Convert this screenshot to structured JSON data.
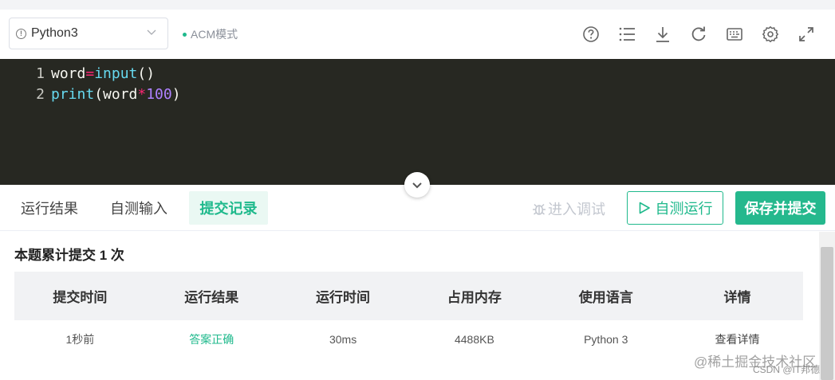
{
  "toolbar": {
    "language": "Python3",
    "mode_label": "ACM模式",
    "icons": [
      "help-icon",
      "list-icon",
      "download-icon",
      "refresh-icon",
      "keyboard-icon",
      "settings-icon",
      "fullscreen-icon"
    ]
  },
  "editor": {
    "lines": [
      {
        "number": "1",
        "tokens": [
          {
            "text": "word",
            "kind": "plain"
          },
          {
            "text": "=",
            "kind": "op"
          },
          {
            "text": "input",
            "kind": "fn"
          },
          {
            "text": "()",
            "kind": "plain"
          }
        ]
      },
      {
        "number": "2",
        "tokens": [
          {
            "text": "print",
            "kind": "fn"
          },
          {
            "text": "(word",
            "kind": "plain"
          },
          {
            "text": "*",
            "kind": "op"
          },
          {
            "text": "100",
            "kind": "num"
          },
          {
            "text": ")",
            "kind": "plain"
          }
        ]
      }
    ]
  },
  "tabs": [
    {
      "label": "运行结果",
      "active": false
    },
    {
      "label": "自测输入",
      "active": false
    },
    {
      "label": "提交记录",
      "active": true
    }
  ],
  "actions": {
    "debug": "进入调试",
    "run": "自测运行",
    "submit": "保存并提交"
  },
  "results": {
    "summary": "本题累计提交 1 次",
    "headers": [
      "提交时间",
      "运行结果",
      "运行时间",
      "占用内存",
      "使用语言",
      "详情"
    ],
    "rows": [
      [
        "1秒前",
        "答案正确",
        "30ms",
        "4488KB",
        "Python 3",
        "查看详情"
      ]
    ]
  },
  "watermark": {
    "main": "@稀土掘金技术社区",
    "sub": "CSDN @IT邦德"
  },
  "colors": {
    "accent": "#1fb98c",
    "editor_bg": "#272822"
  }
}
